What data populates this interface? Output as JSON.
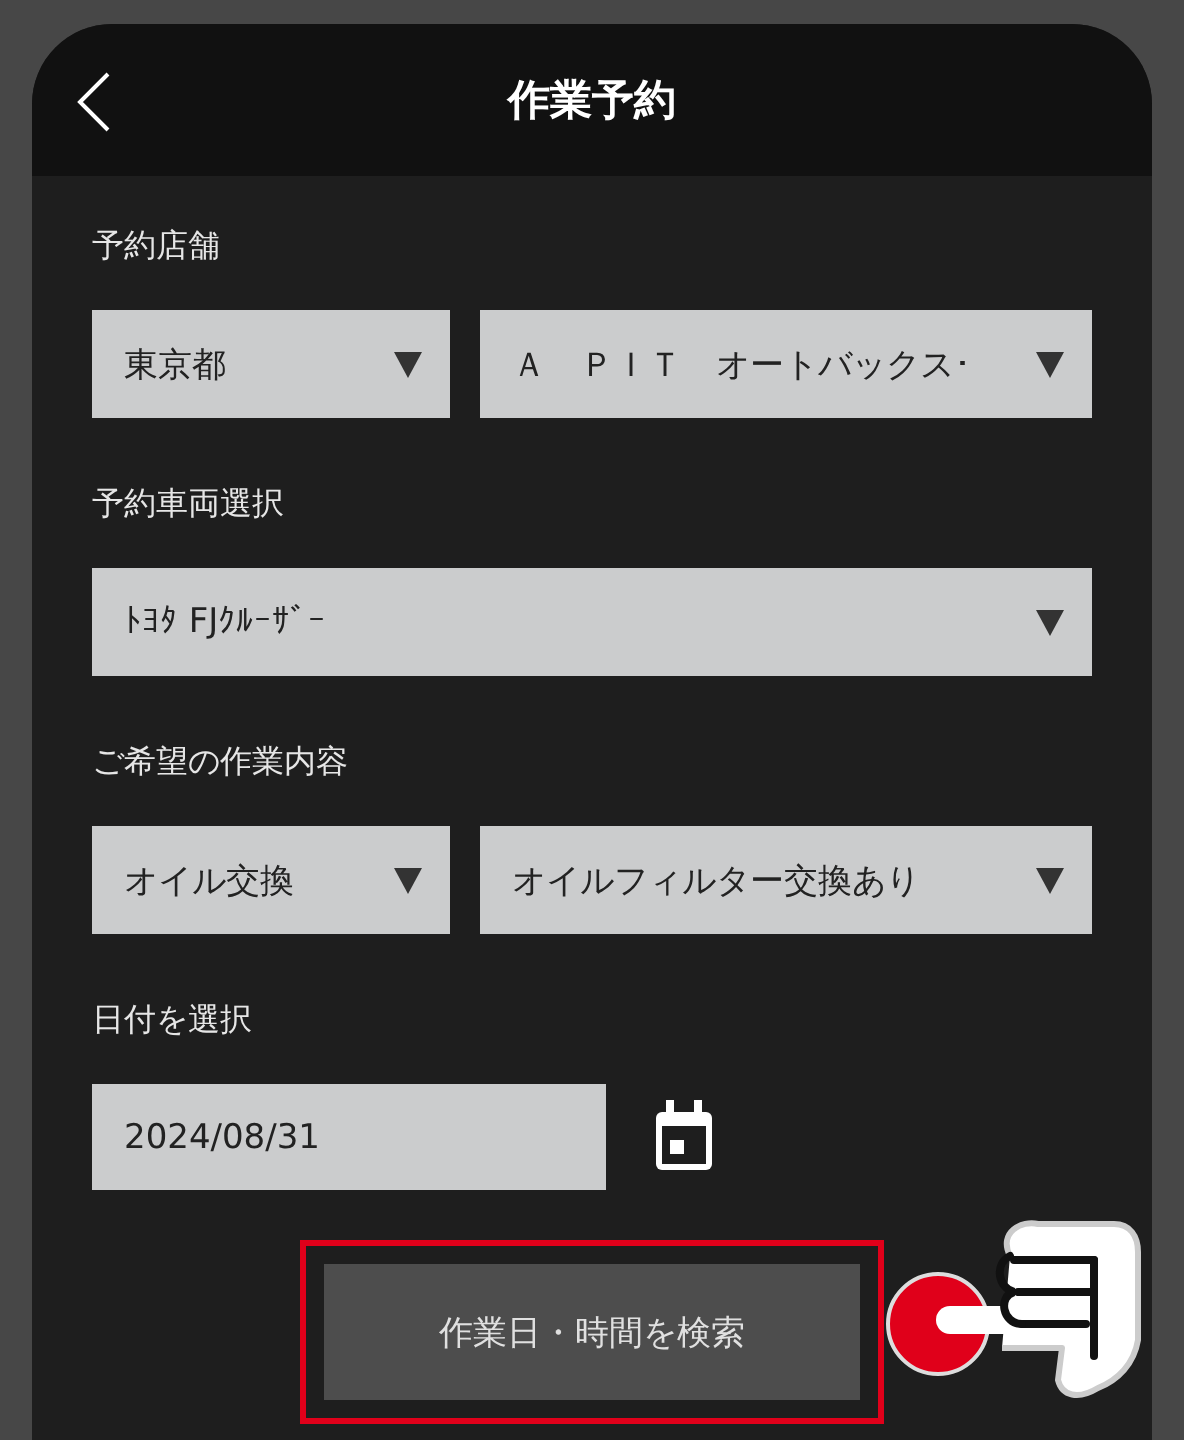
{
  "header": {
    "title": "作業予約"
  },
  "sections": [
    {
      "label": "予約店舗",
      "fields": [
        {
          "kind": "select",
          "value": "東京都"
        },
        {
          "kind": "select",
          "value": "Ａ　ＰＩＴ　オートバックス･"
        }
      ]
    },
    {
      "label": "予約車両選択",
      "fields": [
        {
          "kind": "select",
          "value": "ﾄﾖﾀ FJｸﾙｰｻﾞｰ"
        }
      ]
    },
    {
      "label": "ご希望の作業内容",
      "fields": [
        {
          "kind": "select",
          "value": "オイル交換"
        },
        {
          "kind": "select",
          "value": "オイルフィルター交換あり"
        }
      ]
    },
    {
      "label": "日付を選択",
      "fields": [
        {
          "kind": "date",
          "value": "2024/08/31"
        }
      ]
    }
  ],
  "search_button": {
    "label": "作業日・時間を検索",
    "highlighted": true
  }
}
